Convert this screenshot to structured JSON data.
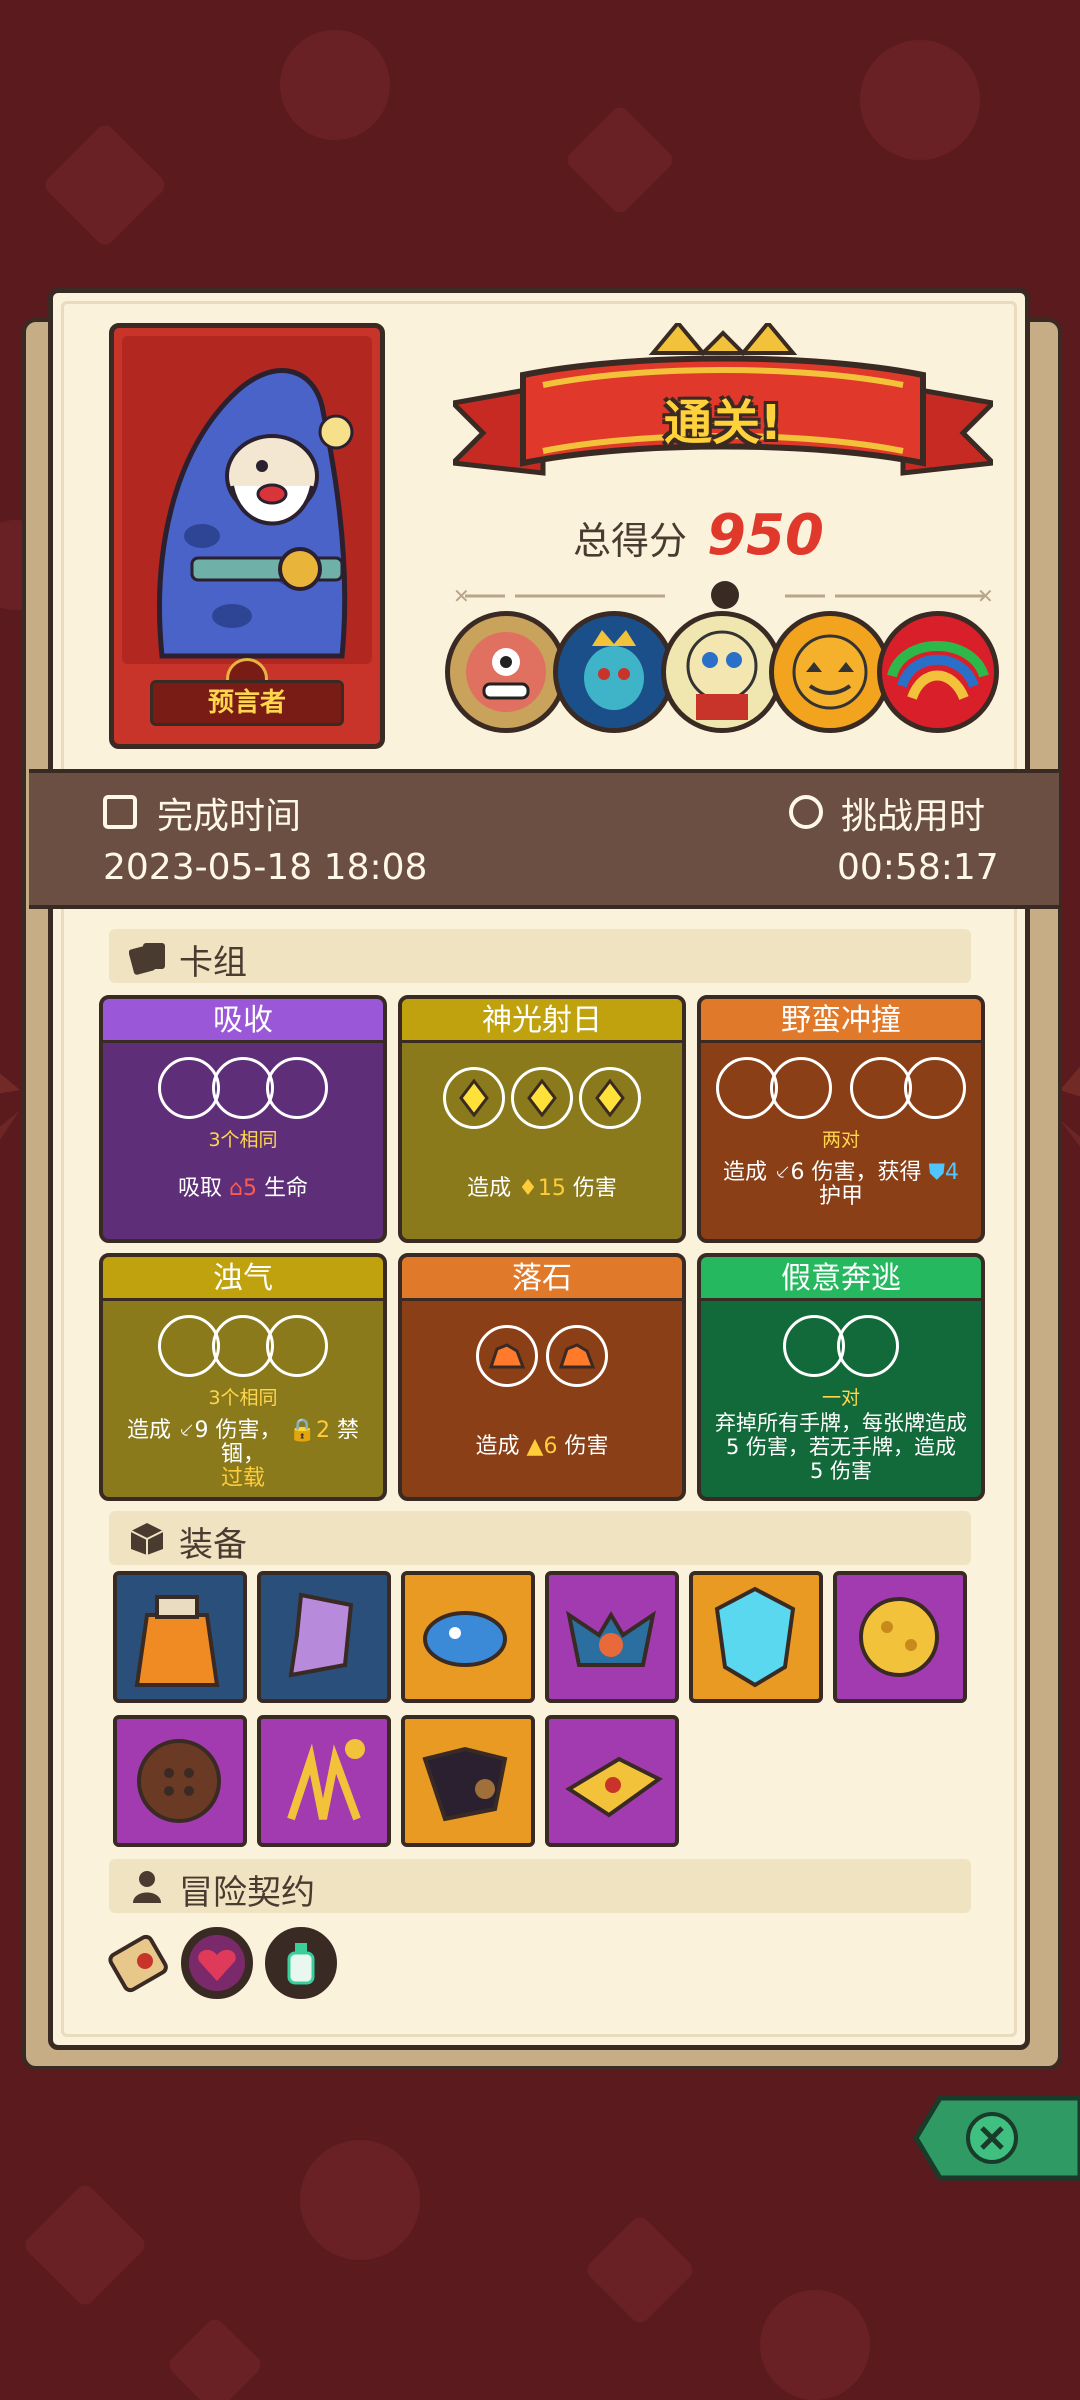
{
  "hero": {
    "name": "预言者"
  },
  "result": {
    "banner": "通关!",
    "score_label": "总得分",
    "score_value": "950"
  },
  "bosses": [
    "cyclops-boss-icon",
    "crowned-demon-boss-icon",
    "skull-mask-boss-icon",
    "pumpkin-boss-icon",
    "rainbow-beast-boss-icon"
  ],
  "time": {
    "finish_label": "完成时间",
    "finish_value": "2023-05-18 18:08",
    "challenge_label": "挑战用时",
    "challenge_value": "00:58:17"
  },
  "deck": {
    "title": "卡组",
    "cards": [
      {
        "name": "吸收",
        "color": "#9a57d8",
        "condition": "3个相同",
        "desc_prefix": "吸取",
        "desc_num": "5",
        "desc_suffix": "生命"
      },
      {
        "name": "神光射日",
        "color": "#c0a20e",
        "desc_prefix": "造成",
        "desc_num": "15",
        "desc_suffix": "伤害"
      },
      {
        "name": "野蛮冲撞",
        "color": "#e07a2a",
        "condition": "两对",
        "desc_prefix": "造成",
        "desc_num": "6",
        "desc_mid": "伤害，获得",
        "desc_num2": "4",
        "desc_suffix": "护甲"
      },
      {
        "name": "浊气",
        "color": "#c0a20e",
        "condition": "3个相同",
        "desc_prefix": "造成",
        "desc_num": "9",
        "desc_mid": "伤害，",
        "desc_num2": "2",
        "desc_mid2": "禁锢，",
        "desc_suffix": "过载"
      },
      {
        "name": "落石",
        "color": "#e07a2a",
        "desc_prefix": "造成",
        "desc_num": "6",
        "desc_suffix": "伤害"
      },
      {
        "name": "假意奔逃",
        "color": "#25b85e",
        "condition": "一对",
        "desc_line1": "弃掉所有手牌，每张牌造成",
        "desc_line2": "5 伤害，若无手牌，造成",
        "desc_line3": "5 伤害"
      }
    ]
  },
  "equipment": {
    "title": "装备",
    "items": [
      "potion-jug-icon",
      "crystal-boot-icon",
      "blue-slime-icon",
      "bat-mask-icon",
      "diamond-shield-icon",
      "golden-orb-icon",
      "button-icon",
      "claw-icon",
      "wolf-pelt-icon",
      "spellbook-icon"
    ]
  },
  "contract": {
    "title": "冒险契约",
    "items": [
      "scroll-icon",
      "heart-lock-icon",
      "potion-bottle-icon"
    ]
  }
}
